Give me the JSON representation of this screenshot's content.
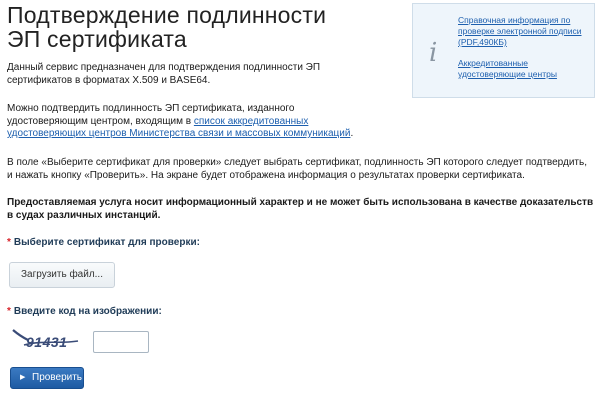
{
  "header": {
    "title_line1": "Подтверждение подлинности",
    "title_line2": "ЭП сертификата"
  },
  "info_box": {
    "icon": "info-icon",
    "link1": "Справочная информация по проверке электронной подписи (PDF,490КБ)",
    "link2": "Аккредитованные удостоверяющие центры"
  },
  "content": {
    "intro": "Данный сервис предназначен для подтверждения подлинности ЭП сертификатов в форматах X.509 и BASE64.",
    "para2_before": "Можно подтвердить подлинность ЭП сертификата, изданного удостоверяющим центром, входящим в ",
    "para2_link": "список аккредитованных удостоверяющих центров Министерства связи и массовых коммуникаций",
    "para2_after": ".",
    "para3": "В поле «Выберите сертификат для проверки» следует выбрать сертификат, подлинность ЭП которого следует подтвердить, и нажать кнопку «Проверить». На экране будет отображена информация о результатах проверки сертификата.",
    "warning": "Предоставляемая услуга носит информационный характер и не может быть использована в качестве доказательств в судах различных инстанций."
  },
  "form": {
    "required_mark": "*",
    "select_label": "Выберите сертификат для проверки:",
    "upload_button": "Загрузить файл...",
    "captcha_label": "Введите код на изображении:",
    "captcha_code": "91431",
    "captcha_input_value": "",
    "submit_button": "Проверить"
  },
  "colors": {
    "link": "#1d5fae",
    "required": "#d8232a",
    "button": "#1e5ba3"
  }
}
